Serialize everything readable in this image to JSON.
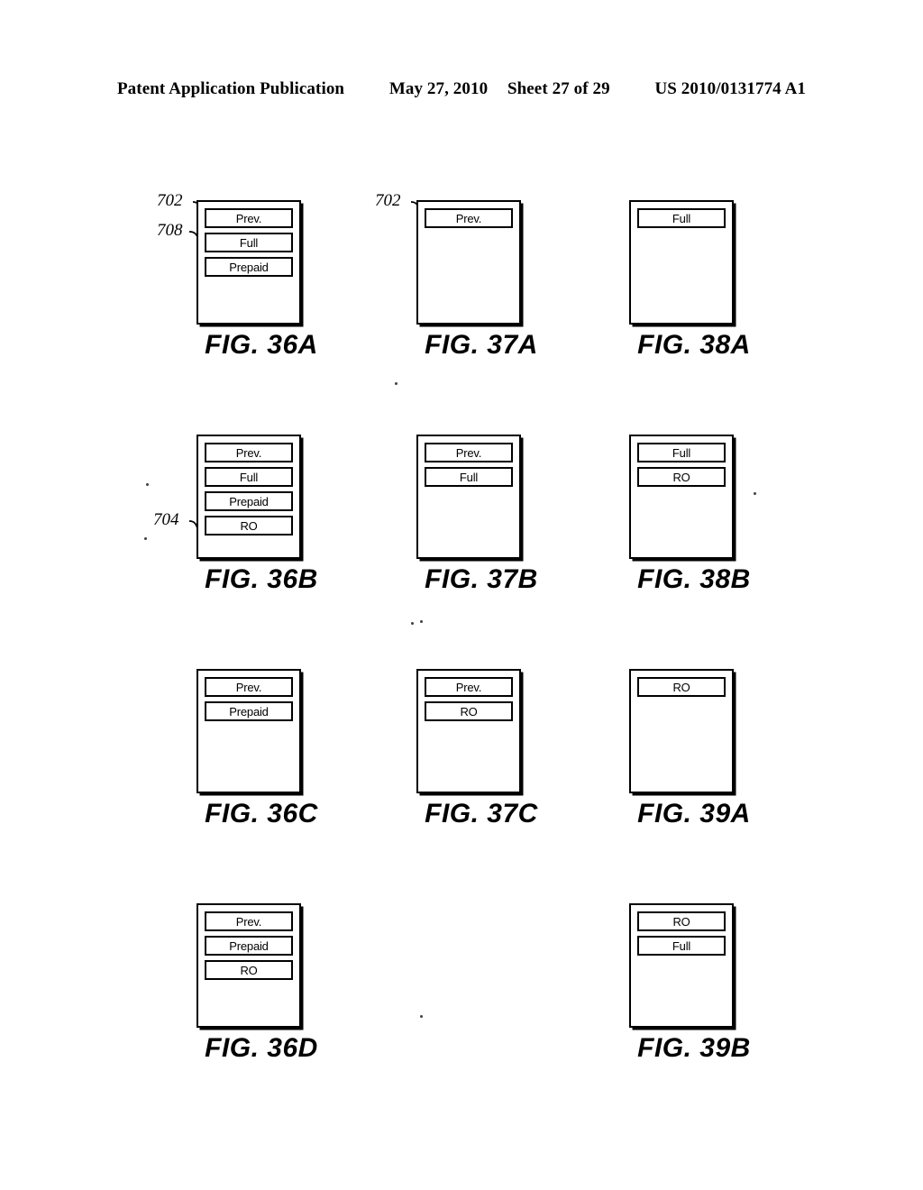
{
  "header": {
    "publication": "Patent Application Publication",
    "date": "May 27, 2010",
    "sheet": "Sheet 27 of 29",
    "doc_number": "US 2010/0131774 A1"
  },
  "figures": [
    {
      "id": "fig-36a",
      "caption": "FIG. 36A",
      "bars": [
        "Prev.",
        "Full",
        "Prepaid"
      ],
      "refs": [
        {
          "label": "702",
          "target": "Prev."
        },
        {
          "label": "708",
          "target": "Full"
        }
      ]
    },
    {
      "id": "fig-37a",
      "caption": "FIG. 37A",
      "bars": [
        "Prev."
      ],
      "refs": [
        {
          "label": "702",
          "target": "Prev."
        }
      ]
    },
    {
      "id": "fig-38a",
      "caption": "FIG. 38A",
      "bars": [
        "Full"
      ],
      "refs": []
    },
    {
      "id": "fig-36b",
      "caption": "FIG. 36B",
      "bars": [
        "Prev.",
        "Full",
        "Prepaid",
        "RO"
      ],
      "refs": [
        {
          "label": "704",
          "target": "RO"
        }
      ]
    },
    {
      "id": "fig-37b",
      "caption": "FIG. 37B",
      "bars": [
        "Prev.",
        "Full"
      ],
      "refs": []
    },
    {
      "id": "fig-38b",
      "caption": "FIG. 38B",
      "bars": [
        "Full",
        "RO"
      ],
      "refs": []
    },
    {
      "id": "fig-36c",
      "caption": "FIG. 36C",
      "bars": [
        "Prev.",
        "Prepaid"
      ],
      "refs": []
    },
    {
      "id": "fig-37c",
      "caption": "FIG. 37C",
      "bars": [
        "Prev.",
        "RO"
      ],
      "refs": []
    },
    {
      "id": "fig-39a",
      "caption": "FIG. 39A",
      "bars": [
        "RO"
      ],
      "refs": []
    },
    {
      "id": "fig-36d",
      "caption": "FIG. 36D",
      "bars": [
        "Prev.",
        "Prepaid",
        "RO"
      ],
      "refs": []
    },
    {
      "id": "fig-39b",
      "caption": "FIG. 39B",
      "bars": [
        "RO",
        "Full"
      ],
      "refs": []
    }
  ]
}
